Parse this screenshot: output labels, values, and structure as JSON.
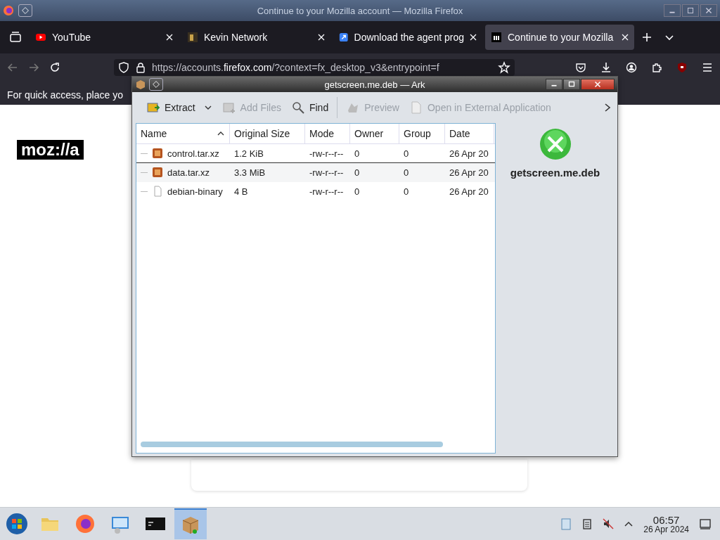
{
  "firefox": {
    "window_title": "Continue to your Mozilla account — Mozilla Firefox",
    "tabs": [
      {
        "label": "YouTube",
        "kind": "youtube",
        "selected": false
      },
      {
        "label": "Kevin Network",
        "kind": "site",
        "selected": false
      },
      {
        "label": "Download the agent prog",
        "kind": "arrow",
        "selected": false
      },
      {
        "label": "Continue to your Mozilla",
        "kind": "mozilla",
        "selected": true
      }
    ],
    "url_prefix": "https://accounts.",
    "url_domain": "firefox.com",
    "url_rest": "/?context=fx_desktop_v3&entrypoint=f",
    "bookmarks_hint": "For quick access, place yo",
    "logo": "moz://a"
  },
  "ark": {
    "title": "getscreen.me.deb — Ark",
    "toolbar": [
      {
        "label": "Extract",
        "kind": "extract",
        "disabled": false,
        "dropdown": true
      },
      {
        "label": "Add Files",
        "kind": "add",
        "disabled": true,
        "dropdown": false
      },
      {
        "label": "Find",
        "kind": "find",
        "disabled": false,
        "dropdown": false
      },
      {
        "label": "Preview",
        "kind": "preview",
        "disabled": true,
        "dropdown": false
      },
      {
        "label": "Open in External Application",
        "kind": "open",
        "disabled": true,
        "dropdown": false
      }
    ],
    "columns": [
      {
        "label": "Name",
        "sorted": true
      },
      {
        "label": "Original Size",
        "sorted": false
      },
      {
        "label": "Mode",
        "sorted": false
      },
      {
        "label": "Owner",
        "sorted": false
      },
      {
        "label": "Group",
        "sorted": false
      },
      {
        "label": "Date",
        "sorted": false
      }
    ],
    "rows": [
      {
        "kind": "archive",
        "cells": [
          "control.tar.xz",
          "1.2 KiB",
          "-rw-r--r--",
          "0",
          "0",
          "26 Apr 20"
        ]
      },
      {
        "kind": "archive",
        "cells": [
          "data.tar.xz",
          "3.3 MiB",
          "-rw-r--r--",
          "0",
          "0",
          "26 Apr 20"
        ]
      },
      {
        "kind": "file",
        "cells": [
          "debian-binary",
          "4 B",
          "-rw-r--r--",
          "0",
          "0",
          "26 Apr 20"
        ]
      }
    ],
    "preview_name": "getscreen.me.deb"
  },
  "taskbar": {
    "apps": [
      {
        "kind": "files",
        "selected": false
      },
      {
        "kind": "firefox",
        "selected": false
      },
      {
        "kind": "network",
        "selected": false
      },
      {
        "kind": "terminal",
        "selected": false
      },
      {
        "kind": "ark",
        "selected": true
      }
    ],
    "time": "06:57",
    "date": "26 Apr 2024"
  }
}
